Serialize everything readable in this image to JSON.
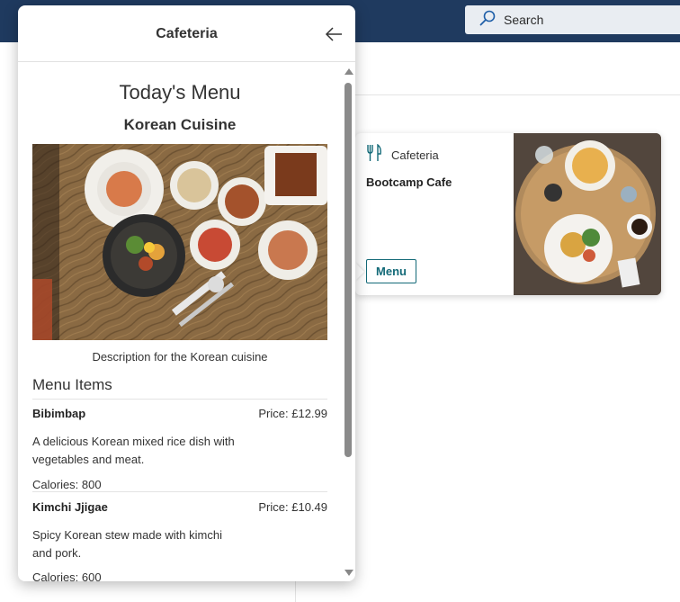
{
  "app": {
    "search_placeholder": "Search"
  },
  "card": {
    "kind": "Cafeteria",
    "title": "Bootcamp Cafe",
    "menu_button": "Menu"
  },
  "panel": {
    "title": "Cafeteria",
    "heading": "Today's Menu",
    "cuisine": "Korean Cuisine",
    "image_description": "Description for the Korean cuisine",
    "items_heading": "Menu Items",
    "items": [
      {
        "name": "Bibimbap",
        "price": "Price: £12.99",
        "description": "A delicious Korean mixed rice dish with vegetables and meat.",
        "calories": "Calories: 800"
      },
      {
        "name": "Kimchi Jjigae",
        "price": "Price: £10.49",
        "description": "Spicy Korean stew made with kimchi and pork.",
        "calories": "Calories: 600"
      }
    ]
  },
  "colors": {
    "topbar": "#1f3a5f",
    "accent": "#136a78"
  },
  "icons": [
    "search-icon",
    "cutlery-icon",
    "back-arrow-icon"
  ]
}
